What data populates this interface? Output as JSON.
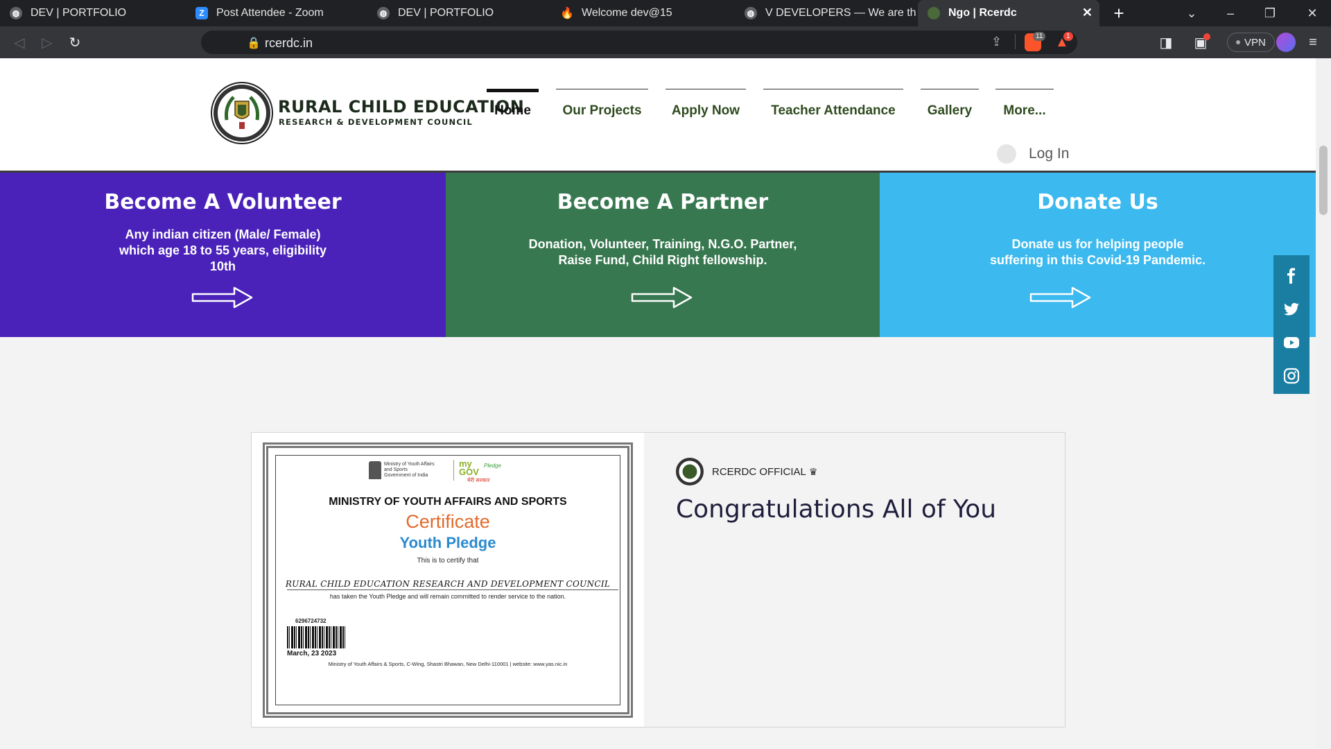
{
  "browser": {
    "tabs": [
      {
        "title": "DEV | PORTFOLIO",
        "icon": "globe-icon"
      },
      {
        "title": "Post Attendee - Zoom",
        "icon": "zoom-icon"
      },
      {
        "title": "DEV | PORTFOLIO",
        "icon": "globe-icon"
      },
      {
        "title": "Welcome dev@15",
        "icon": "flame-icon"
      },
      {
        "title": "V DEVELOPERS — We are the DE",
        "icon": "globe-icon"
      },
      {
        "title": "Ngo | Rcerdc",
        "icon": "site-logo-icon",
        "active": true
      }
    ],
    "url": "rcerdc.in",
    "shields_count": "11",
    "rewards_count": "1",
    "vpn_label": "VPN"
  },
  "site": {
    "logo_title": "RURAL CHILD EDUCATION",
    "logo_subtitle": "RESEARCH & DEVELOPMENT COUNCIL",
    "nav": [
      "Home",
      "Our Projects",
      "Apply Now",
      "Teacher Attendance",
      "Gallery",
      "More..."
    ],
    "login_label": "Log In"
  },
  "cta": {
    "volunteer": {
      "title": "Become A Volunteer",
      "text_lines": [
        "Any indian citizen (Male/ Female)",
        "which age 18 to 55 years, eligibility",
        "10th"
      ]
    },
    "partner": {
      "title": "Become A Partner",
      "text_lines": [
        "Donation, Volunteer, Training, N.G.O. Partner,",
        "Raise Fund, Child Right fellowship."
      ]
    },
    "donate": {
      "title": "Donate Us",
      "text_lines": [
        "Donate us for helping people",
        "suffering in this Covid-19 Pandemic."
      ]
    }
  },
  "colors": {
    "volunteer": "#4a22b9",
    "partner": "#387850",
    "donate": "#3cb9ee",
    "social": "#1a7ea3"
  },
  "social": [
    "facebook-icon",
    "twitter-icon",
    "youtube-icon",
    "instagram-icon"
  ],
  "post": {
    "author": "RCERDC OFFICIAL",
    "title": "Congratulations All of You",
    "certificate": {
      "ministry_small": [
        "Ministry of Youth Affairs",
        "and Sports",
        "Government of India"
      ],
      "mygov": "my GOV",
      "mygov_sub": "मेरी सरकार",
      "pledge_badge": "Pledge",
      "ministry": "MINISTRY OF YOUTH AFFAIRS AND SPORTS",
      "heading": "Certificate",
      "subheading": "Youth Pledge",
      "certify": "This is to certify that",
      "recipient": "RURAL CHILD EDUCATION RESEARCH AND DEVELOPMENT COUNCIL",
      "statement": "has taken the Youth Pledge and will remain committed to render service to the nation.",
      "number": "6296724732",
      "date": "March, 23 2023",
      "footer": "Ministry of Youth Affairs & Sports, C-Wing, Shastri Bhawan, New Delhi-110001 | website: www.yas.nic.in"
    }
  }
}
